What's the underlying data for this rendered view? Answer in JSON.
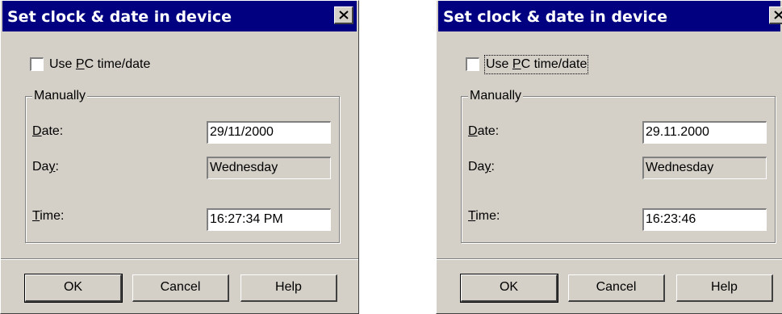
{
  "dialogs": [
    {
      "title": "Set clock & date in device",
      "use_pc": {
        "pre": "Use ",
        "accel": "P",
        "post": "C time/date",
        "checked": false
      },
      "group_label": "Manually",
      "date_label": {
        "accel": "D",
        "rest": "ate:"
      },
      "date_value": "29/11/2000",
      "day_label": {
        "pre": "Da",
        "accel": "y",
        "rest": ":"
      },
      "day_value": "Wednesday",
      "time_label": {
        "accel": "T",
        "rest": "ime:"
      },
      "time_value": "16:27:34 PM",
      "buttons": {
        "ok": "OK",
        "cancel": "Cancel",
        "help": "Help"
      }
    },
    {
      "title": "Set clock & date in device",
      "use_pc": {
        "pre": "Use ",
        "accel": "P",
        "post": "C time/date",
        "checked": false
      },
      "group_label": "Manually",
      "date_label": {
        "accel": "D",
        "rest": "ate:"
      },
      "date_value": "29.11.2000",
      "day_label": {
        "pre": "Da",
        "accel": "y",
        "rest": ":"
      },
      "day_value": "Wednesday",
      "time_label": {
        "accel": "T",
        "rest": "ime:"
      },
      "time_value": "16:23:46",
      "buttons": {
        "ok": "OK",
        "cancel": "Cancel",
        "help": "Help"
      }
    }
  ],
  "colors": {
    "titlebar": "#000080",
    "face": "#d4d0c8",
    "field": "#ffffff"
  }
}
